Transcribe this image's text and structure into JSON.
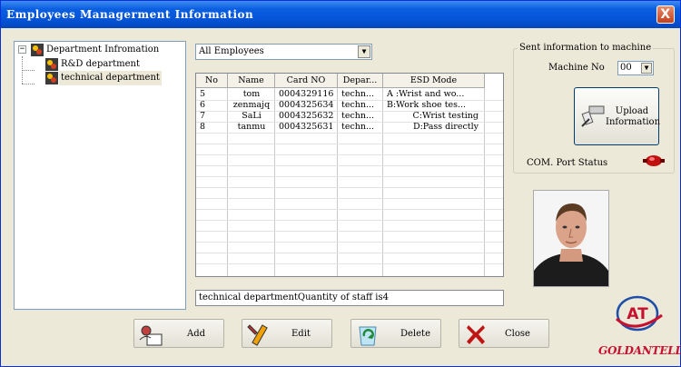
{
  "window": {
    "title": "Employees Managerment Information",
    "close_glyph": "X"
  },
  "tree": {
    "root": {
      "label": "Department Infromation",
      "toggle": "−"
    },
    "children": [
      {
        "label": "R&D department"
      },
      {
        "label": "technical department"
      }
    ]
  },
  "filter": {
    "selected": "All Employees"
  },
  "table": {
    "columns": [
      "No",
      "Name",
      "Card NO",
      "Depar...",
      "ESD Mode"
    ],
    "rows": [
      {
        "no": "5",
        "name": "tom",
        "card": "0004329116",
        "dept": "techn...",
        "esd": "A :Wrist and wo..."
      },
      {
        "no": "6",
        "name": "zenmajq",
        "card": "0004325634",
        "dept": "techn...",
        "esd": "B:Work shoe tes..."
      },
      {
        "no": "7",
        "name": "SaLi",
        "card": "0004325632",
        "dept": "techn...",
        "esd": "C:Wrist testing"
      },
      {
        "no": "8",
        "name": "tanmu",
        "card": "0004325631",
        "dept": "techn...",
        "esd": "D:Pass directly"
      }
    ]
  },
  "status_text": "technical departmentQuantity of staff is4",
  "machine": {
    "legend": "Sent information to machine",
    "machine_no_label": "Machine No",
    "machine_no_value": "00",
    "upload_label_line1": "Upload",
    "upload_label_line2": "Information",
    "com_status_label": "COM. Port Status"
  },
  "buttons": {
    "add": "Add",
    "edit": "Edit",
    "delete": "Delete",
    "close": "Close"
  },
  "logo": {
    "initials": "AT",
    "text": "GOLDANTELL"
  },
  "colors": {
    "titlebar": "#0553d6",
    "window_bg": "#ece9d8",
    "logo_red": "#c8102e",
    "logo_blue": "#1f4fa8"
  }
}
